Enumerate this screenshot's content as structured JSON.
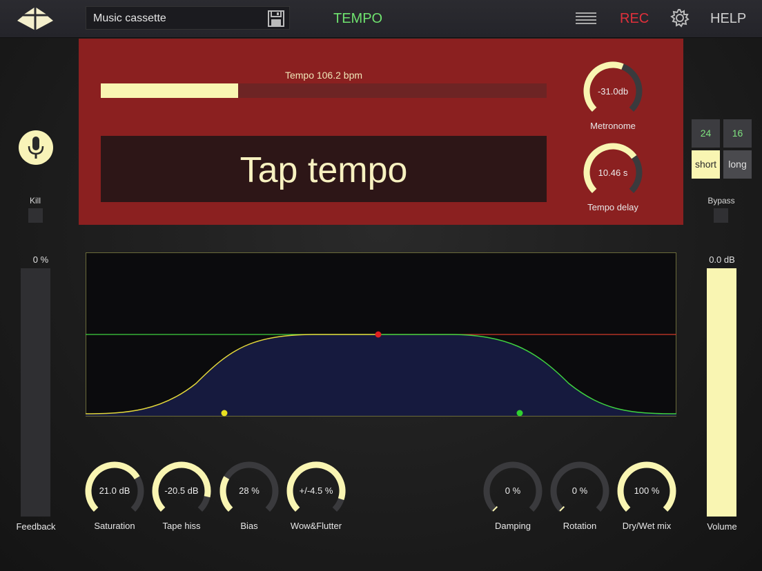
{
  "header": {
    "preset_name": "Music cassette",
    "tab_label": "TEMPO",
    "rec_label": "REC",
    "help_label": "HELP"
  },
  "tempo": {
    "label": "Tempo 106.2 bpm",
    "bar_fraction": 0.308,
    "tap_label": "Tap tempo"
  },
  "top_knobs": [
    {
      "value": "-31.0db",
      "label": "Metronome",
      "fraction": 0.58
    },
    {
      "value": "10.46 s",
      "label": "Tempo delay",
      "fraction": 0.7
    }
  ],
  "left": {
    "kill_label": "Kill",
    "feedback_value": "0 %",
    "feedback_label": "Feedback",
    "feedback_fraction": 0
  },
  "right": {
    "options": [
      "24",
      "16",
      "short",
      "long"
    ],
    "selected": "short",
    "bypass_label": "Bypass",
    "volume_value": "0.0 dB",
    "volume_label": "Volume",
    "volume_fraction": 1.0
  },
  "bottom_knobs": [
    {
      "value": "21.0 dB",
      "label": "Saturation",
      "fraction": 0.72
    },
    {
      "value": "-20.5 dB",
      "label": "Tape hiss",
      "fraction": 0.88
    },
    {
      "value": "28 %",
      "label": "Bias",
      "fraction": 0.28
    },
    {
      "value": "+/-4.5 %",
      "label": "Wow&Flutter",
      "fraction": 0.9
    },
    {
      "value": "0 %",
      "label": "Damping",
      "fraction": 0
    },
    {
      "value": "0 %",
      "label": "Rotation",
      "fraction": 0
    },
    {
      "value": "100 %",
      "label": "Dry/Wet mix",
      "fraction": 1.0
    }
  ],
  "colors": {
    "accent": "#f9f5b2",
    "panel": "#8b2020",
    "tab_green": "#6fe36f",
    "rec_red": "#e0303b",
    "graph_fill": "#161a3e"
  }
}
